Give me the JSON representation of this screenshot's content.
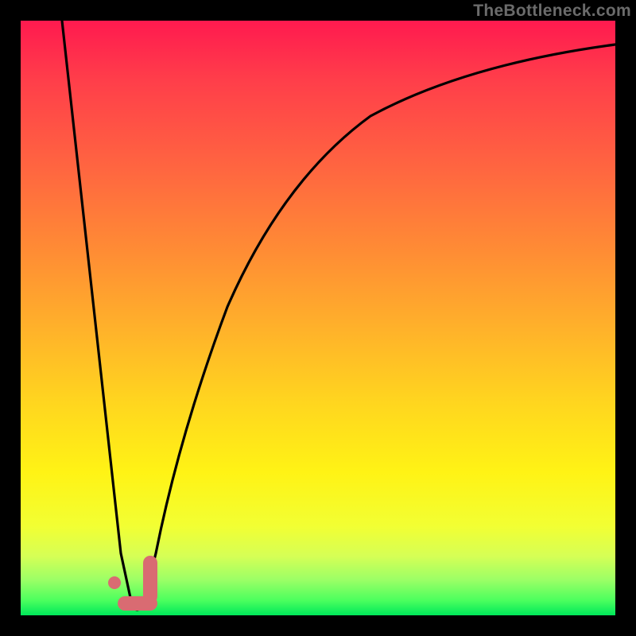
{
  "watermark": "TheBottleneck.com",
  "chart_data": {
    "type": "line",
    "title": "",
    "xlabel": "",
    "ylabel": "",
    "xlim": [
      0,
      100
    ],
    "ylim": [
      0,
      100
    ],
    "series": [
      {
        "name": "bottleneck-curve",
        "x": [
          7,
          12,
          15,
          17,
          18.5,
          20,
          22,
          25,
          30,
          38,
          48,
          60,
          75,
          90,
          100
        ],
        "values": [
          100,
          60,
          30,
          10,
          2,
          3,
          12,
          30,
          55,
          75,
          86,
          92,
          95,
          96.5,
          97
        ]
      }
    ],
    "markers": [
      {
        "name": "dot",
        "x": 15.5,
        "y": 6,
        "shape": "circle",
        "color": "#d96b72"
      },
      {
        "name": "hook-vert",
        "x": 19,
        "y": 3,
        "shape": "capsule-vert",
        "color": "#d96b72"
      },
      {
        "name": "hook-horiz",
        "x": 18,
        "y": 0.5,
        "shape": "capsule-horiz",
        "color": "#d96b72"
      }
    ],
    "background_gradient": {
      "top": "#ff1a4f",
      "mid": "#ffd51f",
      "bottom": "#00e85a"
    }
  }
}
